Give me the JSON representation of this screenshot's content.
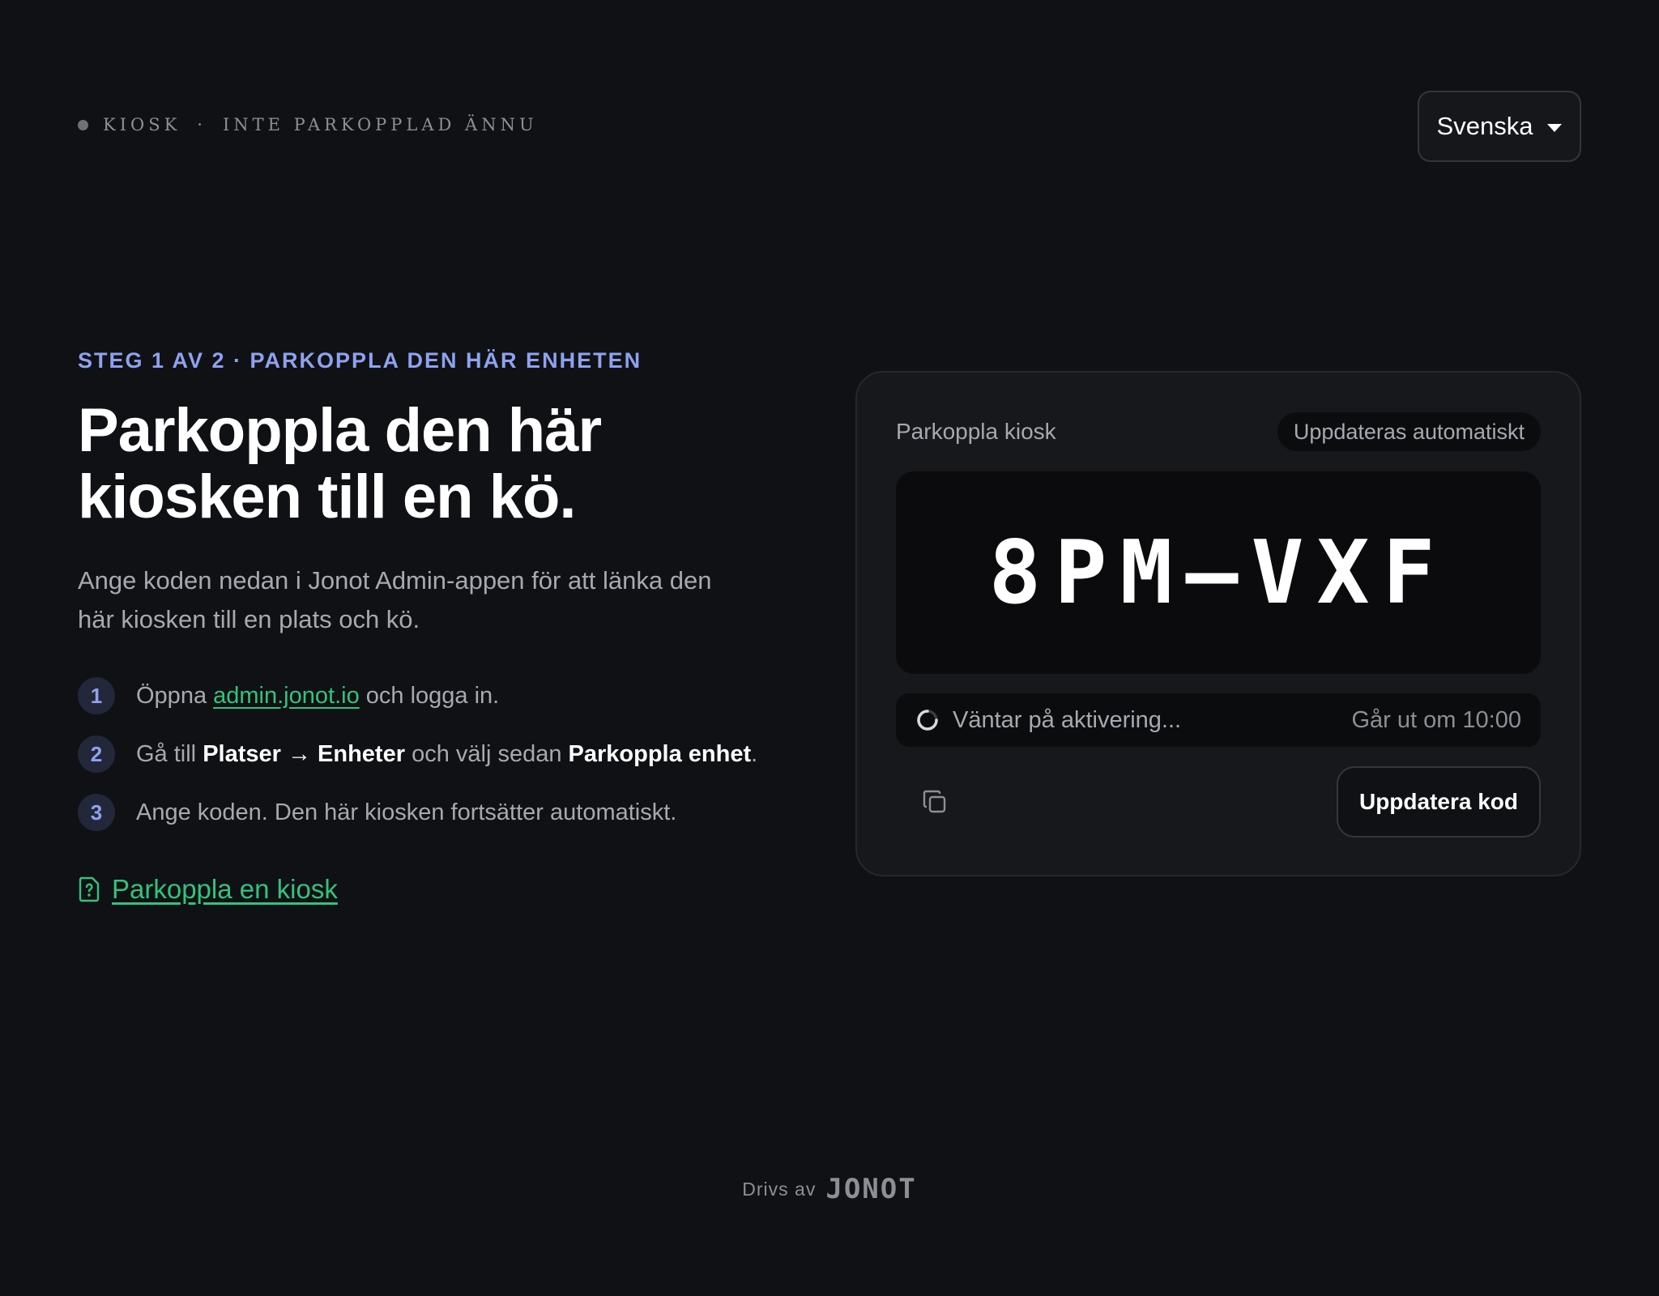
{
  "header": {
    "status_kiosk": "KIOSK",
    "status_separator": "·",
    "status_text": "INTE PARKOPPLAD ÄNNU",
    "language_selected": "Svenska"
  },
  "intro": {
    "eyebrow": "STEG 1 AV 2 · PARKOPPLA DEN HÄR ENHETEN",
    "title_line1": "Parkoppla den här",
    "title_line2": "kiosken till en kö.",
    "lead": "Ange koden nedan i Jonot Admin-appen för att länka den här kiosken till en plats och kö."
  },
  "steps": [
    {
      "number": "1",
      "text_before": "Öppna ",
      "link": "admin.jonot.io",
      "text_after": " och logga in."
    },
    {
      "number": "2",
      "text_before": "Gå till ",
      "bold1": "Platser → Enheter",
      "text_mid": " och välj sedan ",
      "bold2": "Parkoppla enhet",
      "text_after": "."
    },
    {
      "number": "3",
      "text": "Ange koden. Den här kiosken fortsätter automatiskt."
    }
  ],
  "guide_link": "Parkoppla en kiosk",
  "card": {
    "title": "Parkoppla kiosk",
    "badge": "Uppdateras automatiskt",
    "code": "8PM–VXF",
    "waiting_text": "Väntar på aktivering...",
    "expires_text": "Går ut om 10:00",
    "refresh_label": "Uppdatera kod"
  },
  "footer": {
    "powered_by": "Drivs av",
    "brand": "JONOT"
  },
  "colors": {
    "background": "#101114",
    "accent_blue": "#8ea2f0",
    "link_green": "#34c27e",
    "card_bg": "#17181c"
  },
  "icons": {
    "guide": "help-document-icon",
    "copy": "copy-icon",
    "spinner": "spinner-icon",
    "caret": "caret-down-icon"
  }
}
